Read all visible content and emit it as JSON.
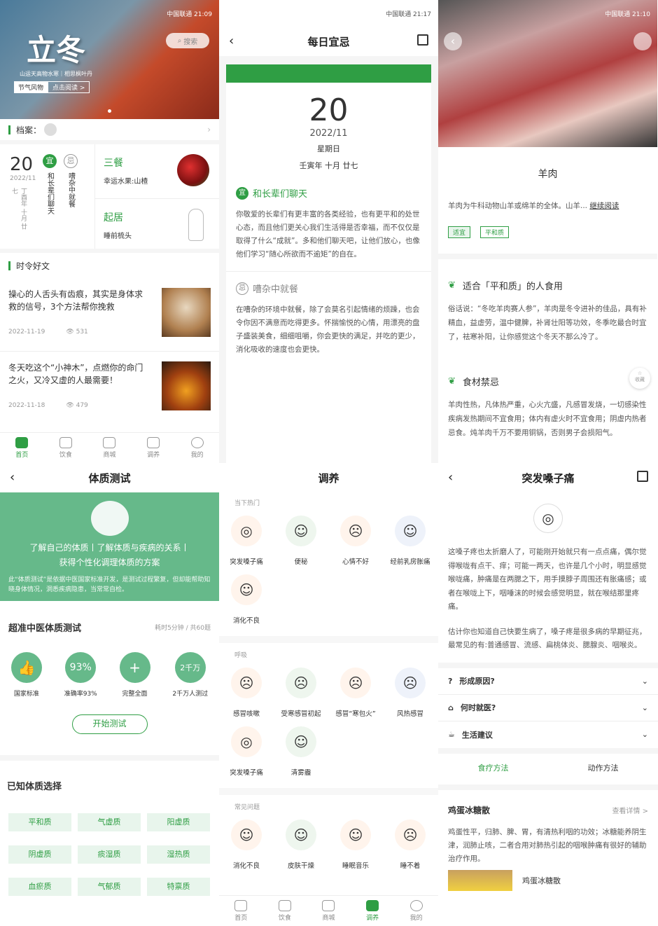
{
  "status": {
    "p1": "中国联通 21:09",
    "p2": "中国联通 21:17",
    "p3": "中国联通 21:10"
  },
  "home": {
    "banner_title": "立冬",
    "banner_sub": "山运天高物水寒｜相思枫叶丹",
    "banner_tag1": "节气风物",
    "banner_tag2": "点击阅读 >",
    "search": "搜索",
    "archive": "档案：",
    "day": "20",
    "ym": "2022/11",
    "lunar": "丁酉年 十月 廿七",
    "yi": "宜",
    "yi_text": "和长辈们聊天",
    "ji": "忌",
    "ji_text": "嘈杂中就餐",
    "meal_title": "三餐",
    "meal_text": "幸运水果:山楂",
    "sleep_title": "起居",
    "sleep_text": "睡前梳头",
    "section": "时令好文",
    "articles": [
      {
        "title": "操心的人舌头有齿痕，其实是身体求救的信号，3个方法帮你挽救",
        "date": "2022-11-19",
        "views": "531"
      },
      {
        "title": "冬天吃这个“小神木”，点燃你的命门之火，又冷又虚的人最需要！",
        "date": "2022-11-18",
        "views": "479"
      }
    ],
    "tabs": [
      "首页",
      "饮食",
      "商城",
      "调养",
      "我的"
    ]
  },
  "daily": {
    "title": "每日宜忌",
    "day": "20",
    "ym": "2022/11",
    "week": "星期日",
    "lunar": "壬寅年 十月 廿七",
    "yi_head": "和长辈们聊天",
    "yi_body": "你敬爱的长辈们有更丰富的各类经验，也有更平和的处世心态，而且他们更关心我们生活得是否幸福，而不仅仅是取得了什么“成就”。多和他们聊天吧，让他们放心，也像他们学习“随心所欲而不逾矩”的自在。",
    "ji_head": "嘈杂中就餐",
    "ji_body": "在嘈杂的环境中就餐，除了会莫名引起情绪的烦躁，也会令你因不满意而吃得更多。怀揣愉悦的心情，用漂亮的盘子盛装美食，细细咀嚼，你会更快的满足，并吃的更少，消化吸收的速度也会更快。"
  },
  "lamb": {
    "name": "羊肉",
    "intro": "羊肉为牛科动物山羊或绵羊的全体。山羊...",
    "more": "继续阅读",
    "tag1": "适宜",
    "tag2": "平和质",
    "s1_title": "适合「平和质」的人食用",
    "s1_body": "俗话说：“冬吃羊肉赛人参”，羊肉是冬令进补的佳品，具有补精血，益虚劳，温中健脾，补肾壮阳等功效，冬季吃最合时宜了，祛寒补阳，让你感觉这个冬天不那么冷了。",
    "s2_title": "食材禁忌",
    "s2_body": "羊肉性热，凡体热严重，心火亢盛，凡感冒发烧，一切感染性疾病发热期间不宜食用；体内有虚火时不宜食用；阴虚内热者忌食。炖羊肉千万不要用铜锅，否则男子会损阳气。",
    "fav": "收藏"
  },
  "test": {
    "title": "体质测试",
    "banner1": "了解自己的体质丨了解体质与疾病的关系丨",
    "banner2": "获得个性化调理体质的方案",
    "banner_note": "此“体质测试”是依据中医国家标准开发，是测试过程繁复，但却能帮助知晓身体情况，洞悉疾病隐患，当常常自检。",
    "exam": "超准中医体质测试",
    "exam_meta": "耗时5分钟 / 共60题",
    "feats": [
      {
        "v": "👍",
        "l": "国家标准"
      },
      {
        "v": "93%",
        "l": "准确率93%"
      },
      {
        "v": "+",
        "l": "完整全面"
      },
      {
        "v": "2千万",
        "l": "2千万人测过"
      }
    ],
    "start": "开始测试",
    "known": "已知体质选择",
    "types": [
      "平和质",
      "气虚质",
      "阳虚质",
      "阴虚质",
      "痰湿质",
      "湿热质",
      "血瘀质",
      "气郁质",
      "特禀质"
    ]
  },
  "care": {
    "title": "调养",
    "g1": "当下热门",
    "g1_items": [
      "突发嗓子痛",
      "便秘",
      "心情不好",
      "经前乳房胀痛",
      "消化不良"
    ],
    "g2": "呼吸",
    "g2_items": [
      "感冒咳嗽",
      "受寒感冒初起",
      "感冒“寒包火”",
      "风热感冒",
      "突发嗓子痛",
      "清雾霾"
    ],
    "g3": "常见问题",
    "g3_items": [
      "消化不良",
      "皮肤干燥",
      "睡眠音乐",
      "睡不着"
    ],
    "tabs": [
      "首页",
      "饮食",
      "商城",
      "调养",
      "我的"
    ]
  },
  "throat": {
    "title": "突发嗓子痛",
    "p1": "这嗓子疼也太折磨人了，可能刚开始就只有一点点痛，偶尔觉得喉咙有点干、痒；可能一两天，也许是几个小时，明显感觉喉咙痛，肿痛是在两腮之下，用手摸脖子周围还有胀痛感；或者在喉咙上下，咽唾沫的时候会感觉明显，就在喉结那里疼痛。",
    "p2": "估计你也知道自己快要生病了，嗓子疼是很多病的早期征兆，最常见的有:普通感冒、流感、扁桃体炎、腮腺炎、咽喉炎。",
    "acc": [
      "形成原因?",
      "何时就医?",
      "生活建议"
    ],
    "tab1": "食疗方法",
    "tab2": "动作方法",
    "recipe": "鸡蛋冰糖散",
    "recipe_more": "查看详情 >",
    "recipe_body": "鸡蛋性平，归肺、脾、胃，有清热利咽的功效；冰糖能养阴生津，润肺止咳，二者合用对肺热引起的咽喉肿痛有很好的辅助治疗作用。",
    "recipe_item": "鸡蛋冰糖散"
  },
  "colors": {
    "green": "#2f9e44",
    "testgreen": "#66b98a"
  }
}
